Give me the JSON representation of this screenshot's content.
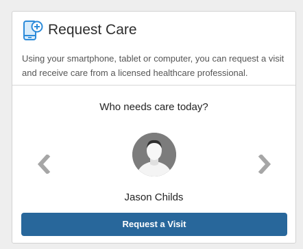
{
  "header": {
    "title": "Request Care",
    "description": "Using your smartphone, tablet or computer, you can request a visit and receive care from a licensed healthcare professional.",
    "icon": "mobile-device-plus-icon"
  },
  "selector": {
    "question": "Who needs care today?",
    "selected_person": "Jason Childs",
    "prev_icon": "chevron-left-icon",
    "next_icon": "chevron-right-icon",
    "avatar_icon": "user-silhouette-icon"
  },
  "actions": {
    "request_label": "Request a Visit"
  },
  "colors": {
    "accent": "#28679b",
    "icon_blue": "#2b8ad9",
    "arrow_gray": "#a6a6a6",
    "avatar_bg": "#7c7c7c"
  }
}
